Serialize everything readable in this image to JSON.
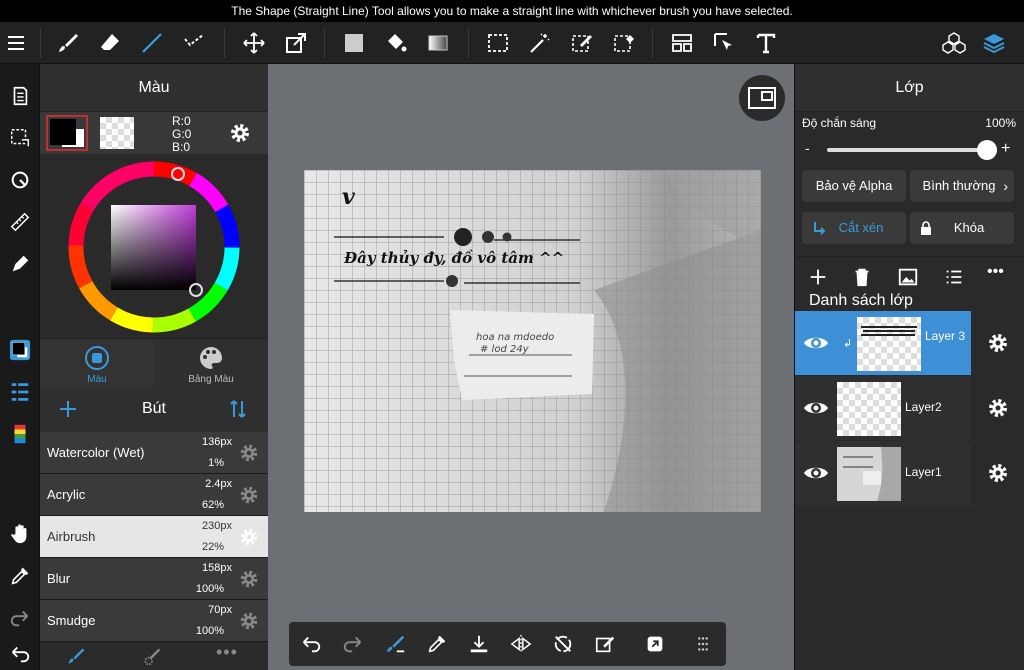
{
  "tooltip": "The Shape (Straight Line) Tool allows you to make a straight line with whichever brush you have selected.",
  "color_panel": {
    "title": "Màu",
    "rgb": {
      "r": "R:0",
      "g": "G:0",
      "b": "B:0"
    },
    "tabs": [
      {
        "label": "Màu"
      },
      {
        "label": "Bảng Màu"
      }
    ],
    "primary_color": "#000000",
    "accent": "#3a9ad9"
  },
  "brush_panel": {
    "title": "Bút",
    "brushes": [
      {
        "name": "Watercolor (Wet)",
        "size": "136px",
        "opacity": "1%"
      },
      {
        "name": "Acrylic",
        "size": "2.4px",
        "opacity": "62%"
      },
      {
        "name": "Airbrush",
        "size": "230px",
        "opacity": "22%"
      },
      {
        "name": "Blur",
        "size": "158px",
        "opacity": "100%"
      },
      {
        "name": "Smudge",
        "size": "70px",
        "opacity": "100%"
      }
    ]
  },
  "canvas": {
    "handwriting_main": "Đây thủy đy, đồ vô tâm ^^",
    "handwriting_v": "v",
    "note_line1": "hoa na mdoedo",
    "note_line2": "# lod 24y"
  },
  "layer_panel": {
    "title": "Lớp",
    "opacity_label": "Độ chắn sáng",
    "opacity_value": "100%",
    "opacity_fraction": 1.0,
    "minus": "-",
    "plus": "+",
    "alpha_protect": "Bảo vệ Alpha",
    "blend_mode": "Bình thường",
    "clipping": "Cắt xén",
    "lock": "Khóa",
    "list_title": "Danh sách lớp",
    "layers": [
      {
        "name": "Layer 3",
        "selected": true
      },
      {
        "name": "Layer2",
        "selected": false
      },
      {
        "name": "Layer1",
        "selected": false
      }
    ]
  }
}
